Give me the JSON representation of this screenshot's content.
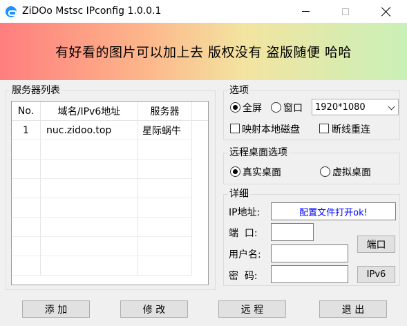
{
  "window": {
    "title": "ZiDOo Mstsc IPconfig 1.0.0.1"
  },
  "banner": {
    "text": "有好看的图片可以加上去  版权没有  盗版随便   哈哈"
  },
  "server_list": {
    "group_title": "服务器列表",
    "columns": [
      "No.",
      "域名/IPv6地址",
      "服务器"
    ],
    "rows": [
      {
        "no": "1",
        "address": "nuc.zidoo.top",
        "server": "星际蜗牛"
      }
    ]
  },
  "options": {
    "group_title": "选项",
    "fullscreen_label": "全屏",
    "window_label": "窗口",
    "screen_mode": "fullscreen",
    "resolution": "1920*1080",
    "map_local_disk_label": "映射本地磁盘",
    "map_local_disk_checked": false,
    "reconnect_label": "断线重连",
    "reconnect_checked": false
  },
  "desktop": {
    "group_title": "远程桌面选项",
    "real_label": "真实桌面",
    "virtual_label": "虚拟桌面",
    "selected": "real"
  },
  "details": {
    "group_title": "详细",
    "ip_label": "IP地址:",
    "ip_value": "配置文件打开ok!",
    "port_label": "端  口:",
    "port_value": "",
    "user_label": "用户名:",
    "user_value": "",
    "password_label": "密  码:",
    "password_value": "",
    "port_button": "端口",
    "ipv6_button": "IPv6"
  },
  "buttons": {
    "add": "添 加",
    "edit": "修 改",
    "remote": "远 程",
    "exit": "退 出"
  }
}
